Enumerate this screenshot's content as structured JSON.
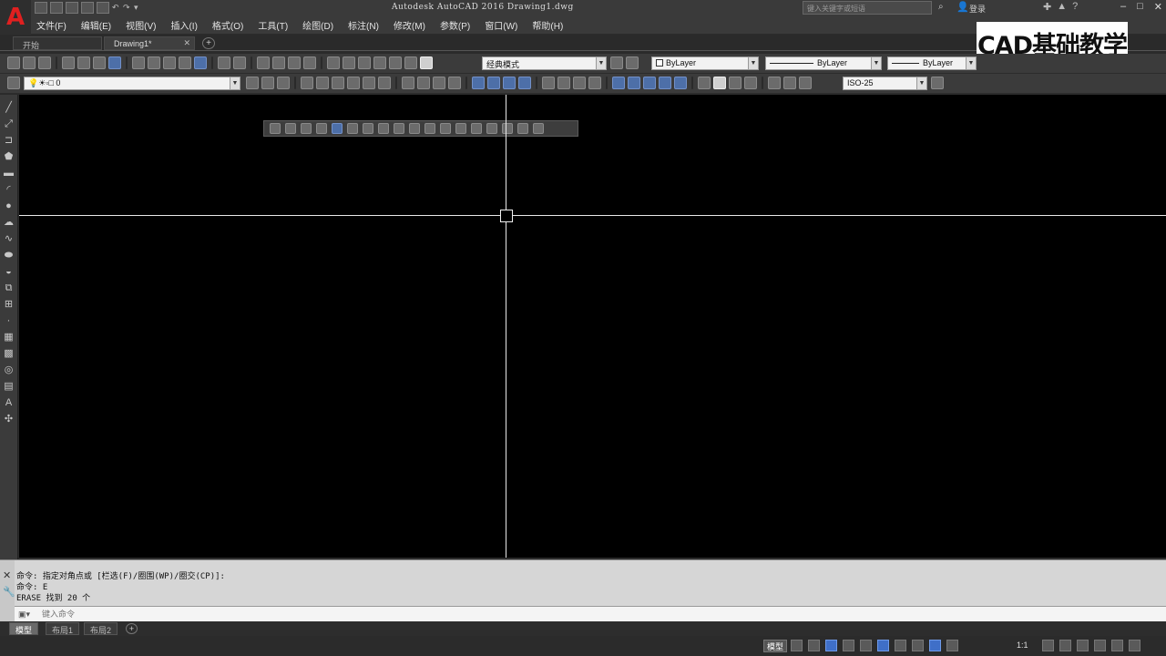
{
  "window": {
    "title": "Autodesk AutoCAD 2016    Drawing1.dwg",
    "search_placeholder": "键入关键字或短语",
    "user": "登录"
  },
  "menu": [
    "文件(F)",
    "编辑(E)",
    "视图(V)",
    "插入(I)",
    "格式(O)",
    "工具(T)",
    "绘图(D)",
    "标注(N)",
    "修改(M)",
    "参数(P)",
    "窗口(W)",
    "帮助(H)"
  ],
  "tabs": {
    "start": "开始",
    "drawing": "Drawing1*"
  },
  "watermark": "CAD基础教学",
  "toolbar": {
    "workspace": "经典模式",
    "color": "ByLayer",
    "linetype": "ByLayer",
    "lineweight": "ByLayer",
    "layer": "0",
    "dimstyle": "ISO-25"
  },
  "command": {
    "lines": [
      "命令: 指定对角点或 [栏选(F)/圈围(WP)/圈交(CP)]:",
      "命令: E",
      "ERASE 找到 20 个"
    ],
    "input_placeholder": "键入命令"
  },
  "layout_tabs": [
    "模型",
    "布局1",
    "布局2"
  ],
  "status": {
    "model": "模型",
    "scale": "1:1"
  }
}
